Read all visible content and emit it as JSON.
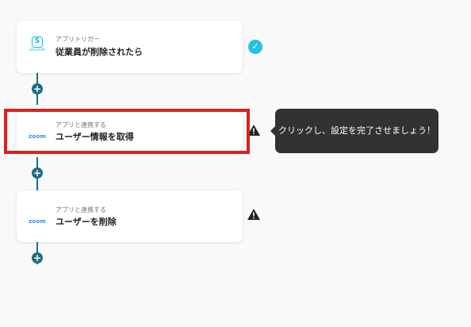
{
  "steps": [
    {
      "app_logo": "SmartHR",
      "app_logo_text": "SmartHR",
      "logo_icon": "smarthr-logo-icon",
      "subtitle": "アプリトリガー",
      "title": "従業員が削除されたら",
      "status": "check"
    },
    {
      "app_logo": "zoom",
      "app_logo_text": "zoom",
      "logo_icon": "zoom-logo-icon",
      "subtitle": "アプリと連携する",
      "title": "ユーザー情報を取得",
      "status": "warning"
    },
    {
      "app_logo": "zoom",
      "app_logo_text": "zoom",
      "logo_icon": "zoom-logo-icon",
      "subtitle": "アプリと連携する",
      "title": "ユーザーを削除",
      "status": "warning"
    }
  ],
  "add_button_label": "+",
  "tooltip_text": "クリックし、設定を完了させましょう！",
  "colors": {
    "flow_line": "#1e6e82",
    "highlight": "#dd1f1f",
    "check": "#25c3e0",
    "tooltip_bg": "#323232"
  }
}
